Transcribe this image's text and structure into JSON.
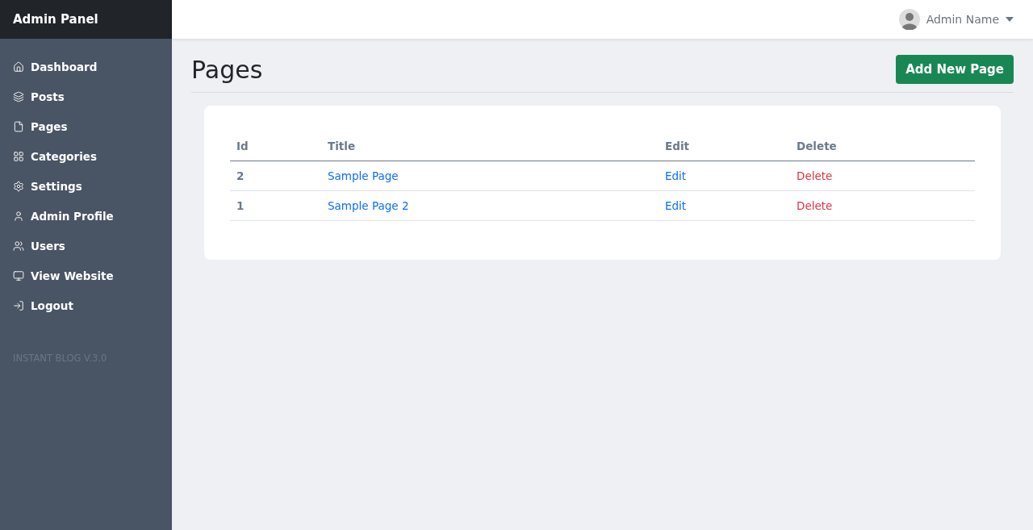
{
  "sidebar": {
    "title": "Admin Panel",
    "items": [
      {
        "label": "Dashboard"
      },
      {
        "label": "Posts"
      },
      {
        "label": "Pages"
      },
      {
        "label": "Categories"
      },
      {
        "label": "Settings"
      },
      {
        "label": "Admin Profile"
      },
      {
        "label": "Users"
      },
      {
        "label": "View Website"
      },
      {
        "label": "Logout"
      }
    ],
    "version": "INSTANT BLOG V.3.0"
  },
  "topbar": {
    "user": "Admin Name"
  },
  "page": {
    "title": "Pages",
    "add_button": "Add New Page"
  },
  "table": {
    "columns": [
      "Id",
      "Title",
      "Edit",
      "Delete"
    ],
    "rows": [
      {
        "id": "2",
        "title": "Sample Page",
        "edit": "Edit",
        "delete": "Delete"
      },
      {
        "id": "1",
        "title": "Sample Page 2",
        "edit": "Edit",
        "delete": "Delete"
      }
    ]
  }
}
